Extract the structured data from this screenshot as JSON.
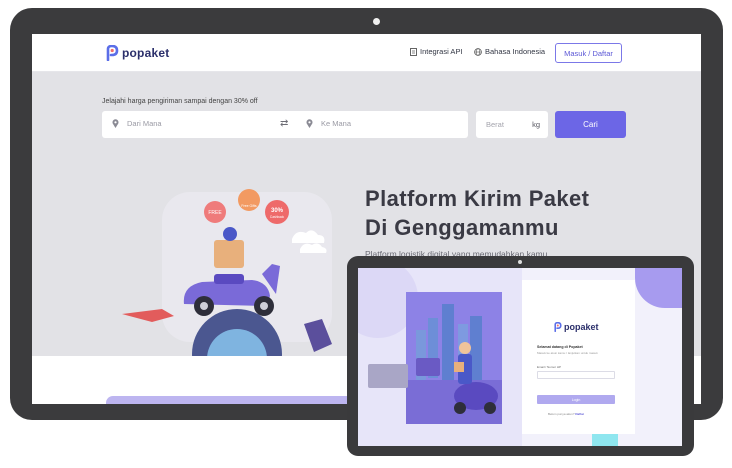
{
  "brand": {
    "name": "popaket",
    "color": "#6c66e6"
  },
  "nav": {
    "integrasi_api": "Integrasi API",
    "language": "Bahasa Indonesia",
    "login_button": "Masuk / Daftar"
  },
  "search": {
    "promo": "Jelajahi harga pengiriman sampai dengan 30% off",
    "from_placeholder": "Dari Mana",
    "to_placeholder": "Ke Mana",
    "weight_placeholder": "Berat",
    "weight_unit": "kg",
    "submit": "Cari"
  },
  "hero": {
    "title_line1": "Platform Kirim Paket",
    "title_line2": "Di Genggamanmu",
    "subtitle": "Platform logistik digital yang memudahkan kamu"
  },
  "illustration": {
    "badge_1": "FREE",
    "badge_2": "Free Gifts",
    "badge_3": "30%",
    "badge_3_sub": "Cashback"
  },
  "tablet": {
    "brand": "popaket",
    "welcome": "Selamat datang di Popaket",
    "hint": "Masuk ke akun kamu / lanjutkan untuk masuk",
    "email_label": "Email / Nomor HP",
    "login_button": "Login",
    "signup_prefix": "Belum punya akun?",
    "signup_link": "Daftar"
  }
}
